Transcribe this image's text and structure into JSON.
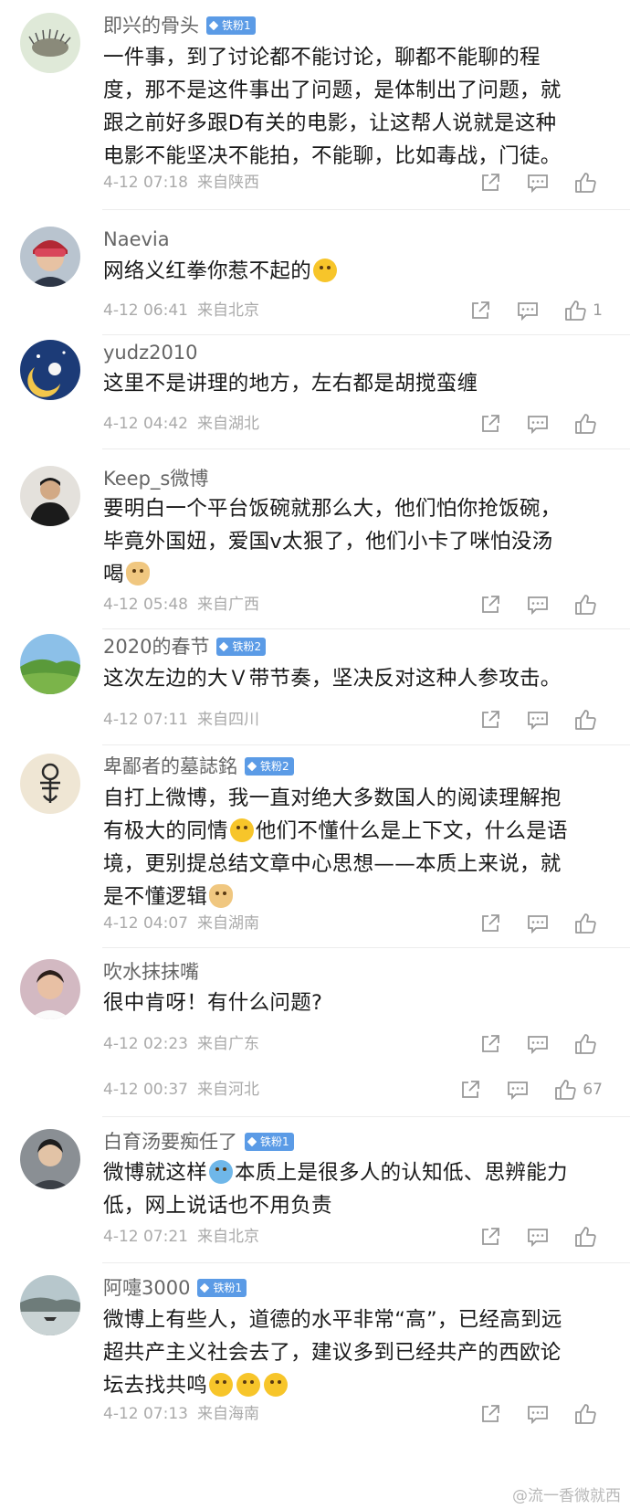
{
  "comments": [
    {
      "username": "即兴的骨头",
      "badge": "铁粉1",
      "lines": [
        "一件事，到了讨论都不能讨论，聊都不能聊的程",
        "度，那不是这件事出了问题，是体制出了问题，就",
        "跟之前好多跟D有关的电影，让这帮人说就是这种",
        "电影不能坚决不能拍，不能聊，比如毒战，门徒。"
      ],
      "time": "4-12 07:18",
      "location": "来自陕西",
      "likes": ""
    },
    {
      "username": "Naevia",
      "badge": "",
      "lines": [
        "网络义红拳你惹不起的"
      ],
      "time": "4-12 06:41",
      "location": "来自北京",
      "likes": "1"
    },
    {
      "username": "yudz2010",
      "badge": "",
      "lines": [
        "这里不是讲理的地方，左右都是胡搅蛮缠"
      ],
      "time": "4-12 04:42",
      "location": "来自湖北",
      "likes": ""
    },
    {
      "username": "Keep_s微博",
      "badge": "",
      "lines": [
        "要明白一个平台饭碗就那么大，他们怕你抢饭碗，",
        "毕竟外国妞，爱国v太狠了，他们小卡了咪怕没汤",
        "喝"
      ],
      "time": "4-12 05:48",
      "location": "来自广西",
      "likes": ""
    },
    {
      "username": "2020的春节",
      "badge": "铁粉2",
      "lines": [
        "这次左边的大Ｖ带节奏，坚决反对这种人参攻击。"
      ],
      "time": "4-12 07:11",
      "location": "来自四川",
      "likes": ""
    },
    {
      "username": "卑鄙者的墓誌銘",
      "badge": "铁粉2",
      "lines": [
        "自打上微博，我一直对绝大多数国人的阅读理解抱",
        "有极大的同情",
        "他们不懂什么是上下文，什么是语",
        "境，更别提总结文章中心思想——本质上来说，就",
        "是不懂逻辑"
      ],
      "time": "4-12 04:07",
      "location": "来自湖南",
      "likes": ""
    },
    {
      "username": "吹水抹抹嘴",
      "badge": "",
      "lines": [
        "很中肯呀！有什么问题?"
      ],
      "time": "4-12 02:23",
      "location": "来自广东",
      "likes": ""
    },
    {
      "username": "",
      "badge": "",
      "lines": [],
      "time": "4-12 00:37",
      "location": "来自河北",
      "likes": "67"
    },
    {
      "username": "白育汤要痴任了",
      "badge": "铁粉1",
      "lines": [
        "微博就这样",
        "本质上是很多人的认知低、思辨能力",
        "低，网上说话也不用负责"
      ],
      "time": "4-12 07:21",
      "location": "来自北京",
      "likes": ""
    },
    {
      "username": "阿嚏3000",
      "badge": "铁粉1",
      "lines": [
        "微博上有些人，道德的水平非常“高”，已经高到远",
        "超共产主义社会去了，建议多到已经共产的西欧论",
        "坛去找共鸣"
      ],
      "time": "4-12 07:13",
      "location": "来自海南",
      "likes": ""
    }
  ],
  "watermark": "@流一香微就西",
  "icons": {
    "share": "share-icon",
    "reply": "comment-icon",
    "like": "thumbs-up-icon"
  },
  "colors": {
    "badge": "#5b9be6",
    "meta": "#aaaaaa",
    "username": "#666666"
  }
}
